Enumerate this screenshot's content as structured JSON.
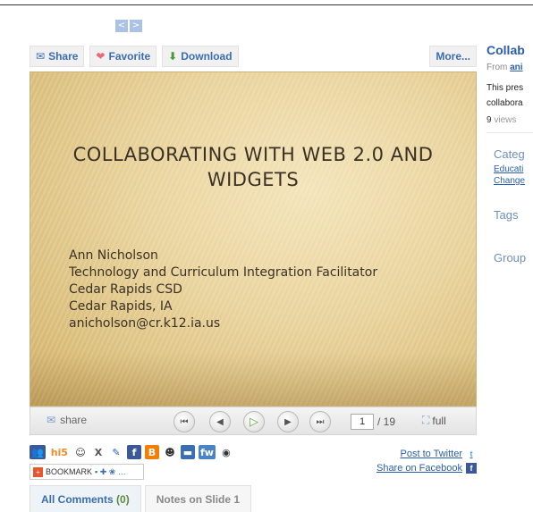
{
  "mini_nav": {
    "prev": "<",
    "next": ">"
  },
  "toolbar": {
    "share": "Share",
    "favorite": "Favorite",
    "download": "Download",
    "more": "More..."
  },
  "slide": {
    "title_line1": "Collaborating with Web 2.0 and",
    "title_line2": "Widgets",
    "body": [
      "Ann Nicholson",
      "Technology and Curriculum Integration Facilitator",
      "Cedar Rapids CSD",
      "Cedar Rapids, IA",
      "anicholson@cr.k12.ia.us"
    ]
  },
  "player": {
    "share": "share",
    "current_page": "1",
    "total_pages": "/ 19",
    "full": "full"
  },
  "social": {
    "bookmark": "BOOKMARK",
    "post_twitter": "Post to Twitter",
    "share_facebook": "Share on Facebook"
  },
  "comments": {
    "all_label": "All Comments",
    "all_count": "(0)",
    "notes": "Notes on Slide 1"
  },
  "sidebar": {
    "title": "Collab",
    "from_label": "From",
    "from_user": "ani",
    "desc_line1": "This pres",
    "desc_line2": "collabora",
    "views_count": "9",
    "views_label": "views",
    "categories": "Categ",
    "cat_link1": "Educati",
    "cat_link2": "Change",
    "tags": "Tags",
    "groups": "Group"
  },
  "colors": {
    "link": "#2a5db0",
    "slide_gold": "#e8d29a",
    "play_green": "#5dab3c"
  }
}
